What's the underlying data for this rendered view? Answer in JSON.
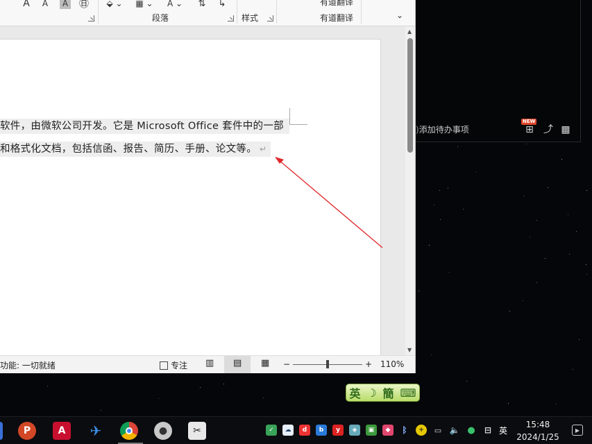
{
  "ribbon": {
    "font_a_large": "A",
    "font_a_small": "A",
    "font_highlight": "A",
    "paragraph_label": "段落",
    "styles_label": "样式",
    "youdao_top": "有道翻译",
    "youdao_label": "有道翻译"
  },
  "document": {
    "line1": "软件，由微软公司开发。它是 Microsoft  Office 套件中的一部",
    "line2": "和格式化文档，包括信函、报告、简历、手册、论文等。",
    "paragraph_mark": "↵"
  },
  "statusbar": {
    "accessibility": "功能: 一切就绪",
    "focus": "专注",
    "zoom_minus": "−",
    "zoom_plus": "+",
    "zoom_level": "110%",
    "zoom_fraction": 0.5
  },
  "todo": {
    "add_label": "添加待办事项",
    "new_badge": "NEW"
  },
  "ime": {
    "lang": "英",
    "moon": "☽",
    "script": "簡",
    "keyboard": "⌨"
  },
  "taskbar": {
    "apps": [
      "powerpoint-icon",
      "acrobat-icon",
      "feishu-icon",
      "chrome-icon",
      "qq-icon",
      "screenshot-icon"
    ],
    "input_lang": "英",
    "time": "15:48",
    "date": "2024/1/25"
  },
  "colors": {
    "annotation": "#e0262a",
    "desktop": "#04060a",
    "ime_green": "#b9dc6a"
  }
}
